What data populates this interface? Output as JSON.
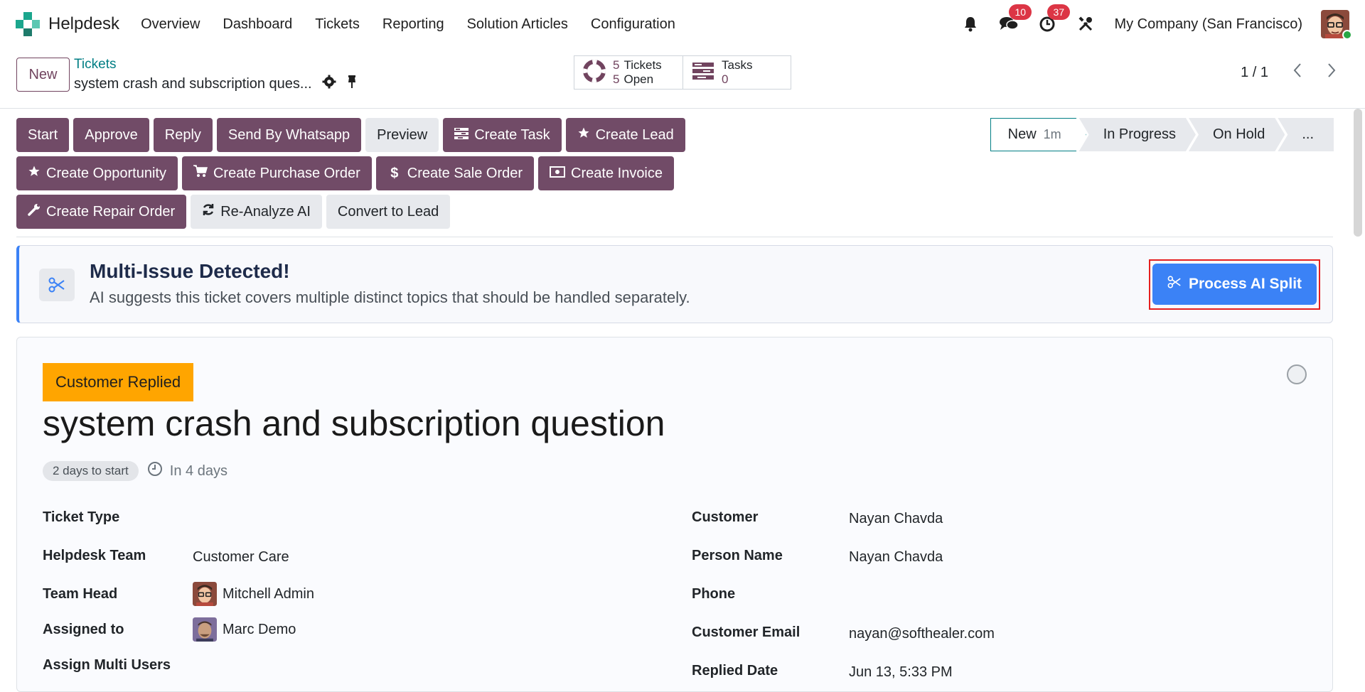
{
  "app": {
    "name": "Helpdesk"
  },
  "menu": [
    "Overview",
    "Dashboard",
    "Tickets",
    "Reporting",
    "Solution Articles",
    "Configuration"
  ],
  "systray": {
    "messages_count": "10",
    "activities_count": "37",
    "company": "My Company (San Francisco)",
    "icons": [
      "bell-icon",
      "chat-icon",
      "clock-icon",
      "tools-icon"
    ]
  },
  "control": {
    "new_label": "New",
    "breadcrumb": "Tickets",
    "record_name": "system crash and subscription ques...",
    "stat_tickets_num": "5",
    "stat_tickets_label": "Tickets",
    "stat_open_num": "5",
    "stat_open_label": "Open",
    "stat_tasks_label": "Tasks",
    "stat_tasks_num": "0",
    "pager": "1 / 1"
  },
  "buttons": {
    "row1": [
      {
        "label": "Start",
        "style": "primary",
        "icon": ""
      },
      {
        "label": "Approve",
        "style": "primary",
        "icon": ""
      },
      {
        "label": "Reply",
        "style": "primary",
        "icon": ""
      },
      {
        "label": "Send By Whatsapp",
        "style": "primary",
        "icon": ""
      },
      {
        "label": "Preview",
        "style": "secondary",
        "icon": ""
      },
      {
        "label": "Create Task",
        "style": "primary",
        "icon": "tasks-icon"
      },
      {
        "label": "Create Lead",
        "style": "primary",
        "icon": "star-icon"
      }
    ],
    "row2": [
      {
        "label": "Create Opportunity",
        "style": "primary",
        "icon": "star-icon"
      },
      {
        "label": "Create Purchase Order",
        "style": "primary",
        "icon": "cart-icon"
      },
      {
        "label": "Create Sale Order",
        "style": "primary",
        "icon": "dollar-icon"
      },
      {
        "label": "Create Invoice",
        "style": "primary",
        "icon": "money-icon"
      }
    ],
    "row3": [
      {
        "label": "Create Repair Order",
        "style": "primary",
        "icon": "wrench-icon"
      },
      {
        "label": "Re-Analyze AI",
        "style": "secondary",
        "icon": "refresh-icon"
      },
      {
        "label": "Convert to Lead",
        "style": "secondary",
        "icon": ""
      }
    ]
  },
  "statusbar": {
    "current": "New",
    "current_duration": "1m",
    "stages": [
      "In Progress",
      "On Hold"
    ],
    "more": "..."
  },
  "alert": {
    "title": "Multi-Issue Detected!",
    "text": "AI suggests this ticket covers multiple distinct topics that should be handled separately.",
    "button": "Process AI Split"
  },
  "ticket": {
    "tag": "Customer Replied",
    "title": "system crash and subscription question",
    "deadline_pill": "2 days to start",
    "deadline_in": "In 4 days"
  },
  "fields_left": [
    {
      "label": "Ticket Type",
      "value": ""
    },
    {
      "label": "Helpdesk Team",
      "value": "Customer Care"
    },
    {
      "label": "Team Head",
      "value": "Mitchell Admin"
    },
    {
      "label": "Assigned to",
      "value": "Marc Demo"
    },
    {
      "label": "Assign Multi Users",
      "value": ""
    }
  ],
  "fields_right": [
    {
      "label": "Customer",
      "value": "Nayan Chavda"
    },
    {
      "label": "Person Name",
      "value": "Nayan Chavda"
    },
    {
      "label": "Phone",
      "value": ""
    },
    {
      "label": "Customer Email",
      "value": "nayan@softhealer.com"
    },
    {
      "label": "Replied Date",
      "value": "Jun 13, 5:33 PM"
    }
  ],
  "colors": {
    "primary": "#714b67",
    "accent": "#017e84",
    "ai_blue": "#3b82f6",
    "tag_orange": "#ffa500",
    "badge_red": "#dc3545"
  }
}
